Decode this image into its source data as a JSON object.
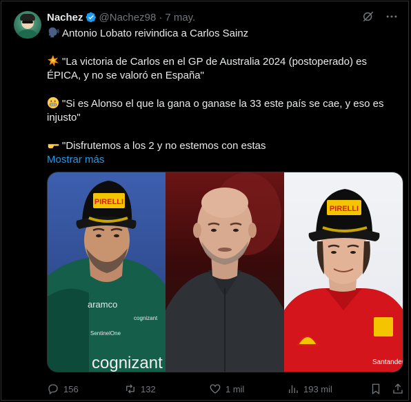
{
  "tweet": {
    "author_name": "Nachez",
    "handle": "@Nachez98",
    "separator": "·",
    "date": "7 may.",
    "lines": {
      "intro": "Antonio Lobato reivindica a Carlos Sainz",
      "quote1": "\"La victoria de Carlos en el GP de Australia 2024 (postoperado) es ÉPICA, y no se valoró en España\"",
      "quote2": "\"Si es Alonso el que la gana o ganase la 33 este país se cae, y eso es injusto\"",
      "quote3": "\"Disfrutemos a los 2 y no estemos con estas"
    },
    "show_more": "Mostrar más",
    "media": {
      "left_cap_logo": "PIRELLI",
      "right_cap_logo": "PIRELLI",
      "left_shirt_text": "cognizant",
      "left_shirt_sponsor": "SentinelOne",
      "right_shirt_text": "Santander",
      "left_chest_text": "aramco",
      "left_chest_right_text": "cognizant"
    }
  },
  "actions": {
    "replies": "156",
    "reposts": "132",
    "likes": "1 mil",
    "views": "193 mil"
  },
  "icons": {
    "verified": "verified-badge-icon",
    "grok": "grok-icon",
    "more": "more-dots-icon",
    "reply": "reply-icon",
    "repost": "repost-icon",
    "like": "heart-icon",
    "views": "views-icon",
    "bookmark": "bookmark-icon",
    "share": "share-icon"
  },
  "colors": {
    "background": "#000000",
    "text": "#e7e9ea",
    "secondary": "#71767b",
    "link": "#1d9bf0",
    "border": "#2f3336"
  }
}
